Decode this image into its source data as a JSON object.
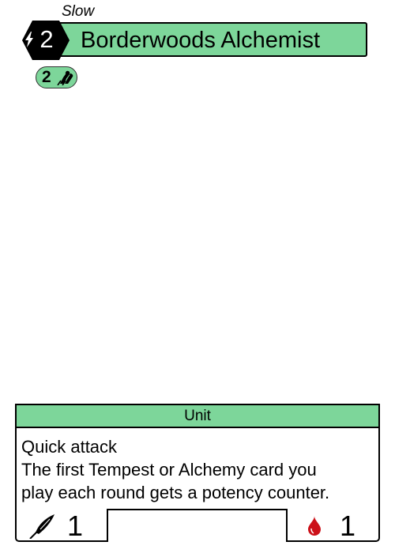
{
  "card": {
    "speed": "Slow",
    "cost": "2",
    "name": "Borderwoods Alchemist",
    "influence_cost": "2",
    "type": "Unit",
    "rules_text": [
      "Quick attack",
      "The first Tempest or Alchemy card you",
      "play each round gets a potency counter."
    ],
    "power": "1",
    "health": "1"
  },
  "colors": {
    "faction_green": "#7dd69a",
    "outline": "#000000",
    "blood_red": "#cc1018"
  },
  "icons": {
    "cost": "lightning-bolt-icon",
    "influence": "stacked-feathers-icon",
    "power": "quill-feather-icon",
    "health": "blood-drop-icon"
  }
}
